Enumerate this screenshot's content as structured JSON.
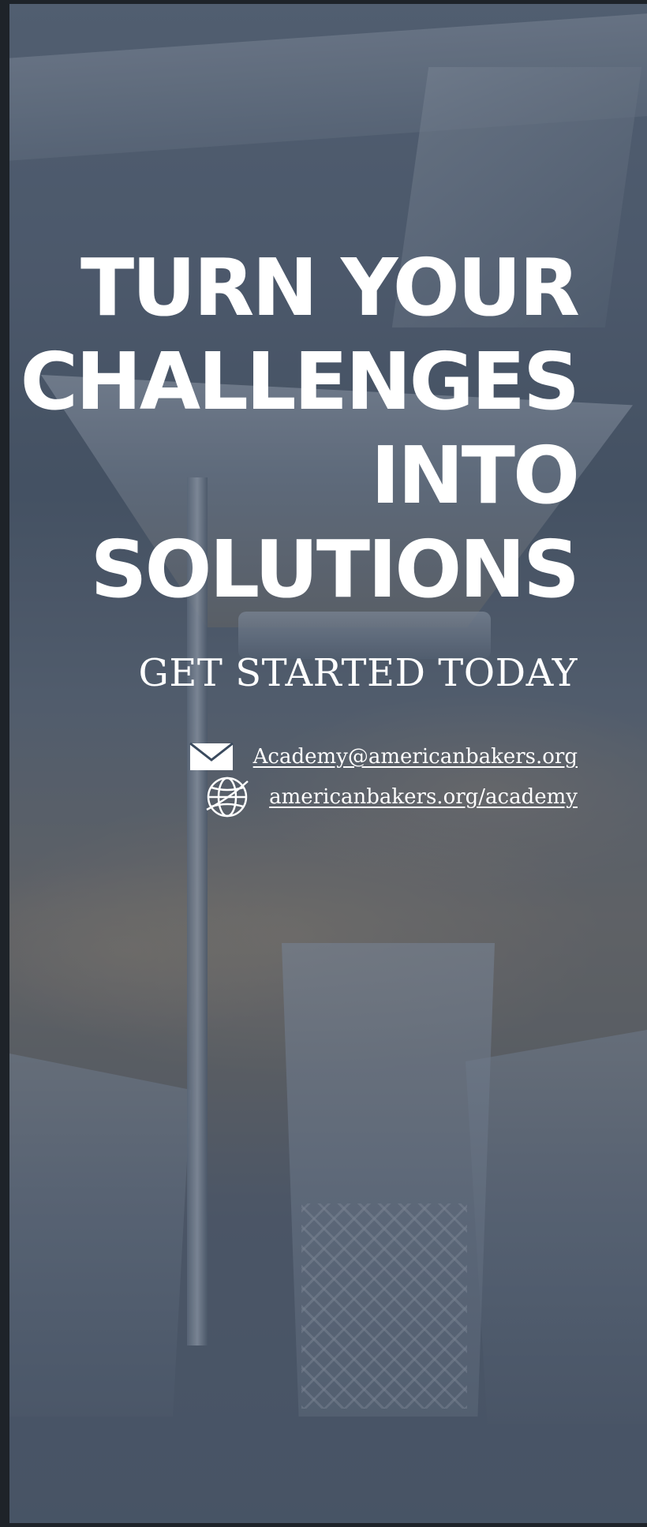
{
  "headline": {
    "lines": [
      "TURN YOUR",
      "CHALLENGES",
      "INTO",
      "SOLUTIONS"
    ]
  },
  "cta": {
    "text": "GET STARTED TODAY"
  },
  "contact": {
    "email": {
      "icon": "envelope-icon",
      "text": "Academy@americanbakers.org"
    },
    "website": {
      "icon": "globe-icon",
      "text": "americanbakers.org/academy"
    }
  },
  "colors": {
    "overlay": "#1c2e48",
    "text": "#ffffff"
  }
}
